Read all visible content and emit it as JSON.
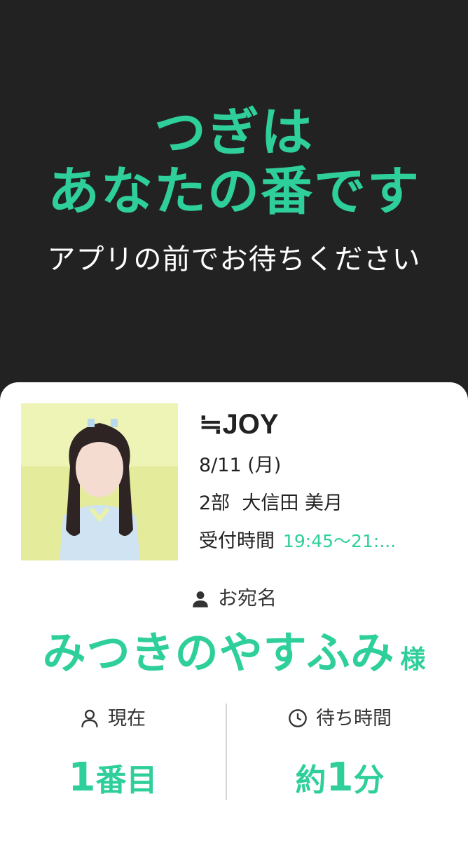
{
  "header": {
    "title_line1": "つぎは",
    "title_line2": "あなたの番です",
    "subtitle": "アプリの前でお待ちください"
  },
  "event": {
    "group": "≒JOY",
    "date": "8/11 (月)",
    "session": "2部",
    "member": "大信田 美月",
    "reception_label": "受付時間",
    "reception_time": "19:45〜21:..."
  },
  "recipient": {
    "label": "お宛名",
    "name": "みつきのやすふみ",
    "honorific": "様"
  },
  "status": {
    "current_label": "現在",
    "current_number": "1",
    "current_suffix": "番目",
    "wait_label": "待ち時間",
    "wait_prefix": "約",
    "wait_number": "1",
    "wait_suffix": "分"
  },
  "colors": {
    "accent": "#2ecf9b",
    "background": "#222222",
    "card": "#ffffff"
  },
  "icons": [
    "person-filled-icon",
    "person-outline-icon",
    "clock-icon"
  ]
}
